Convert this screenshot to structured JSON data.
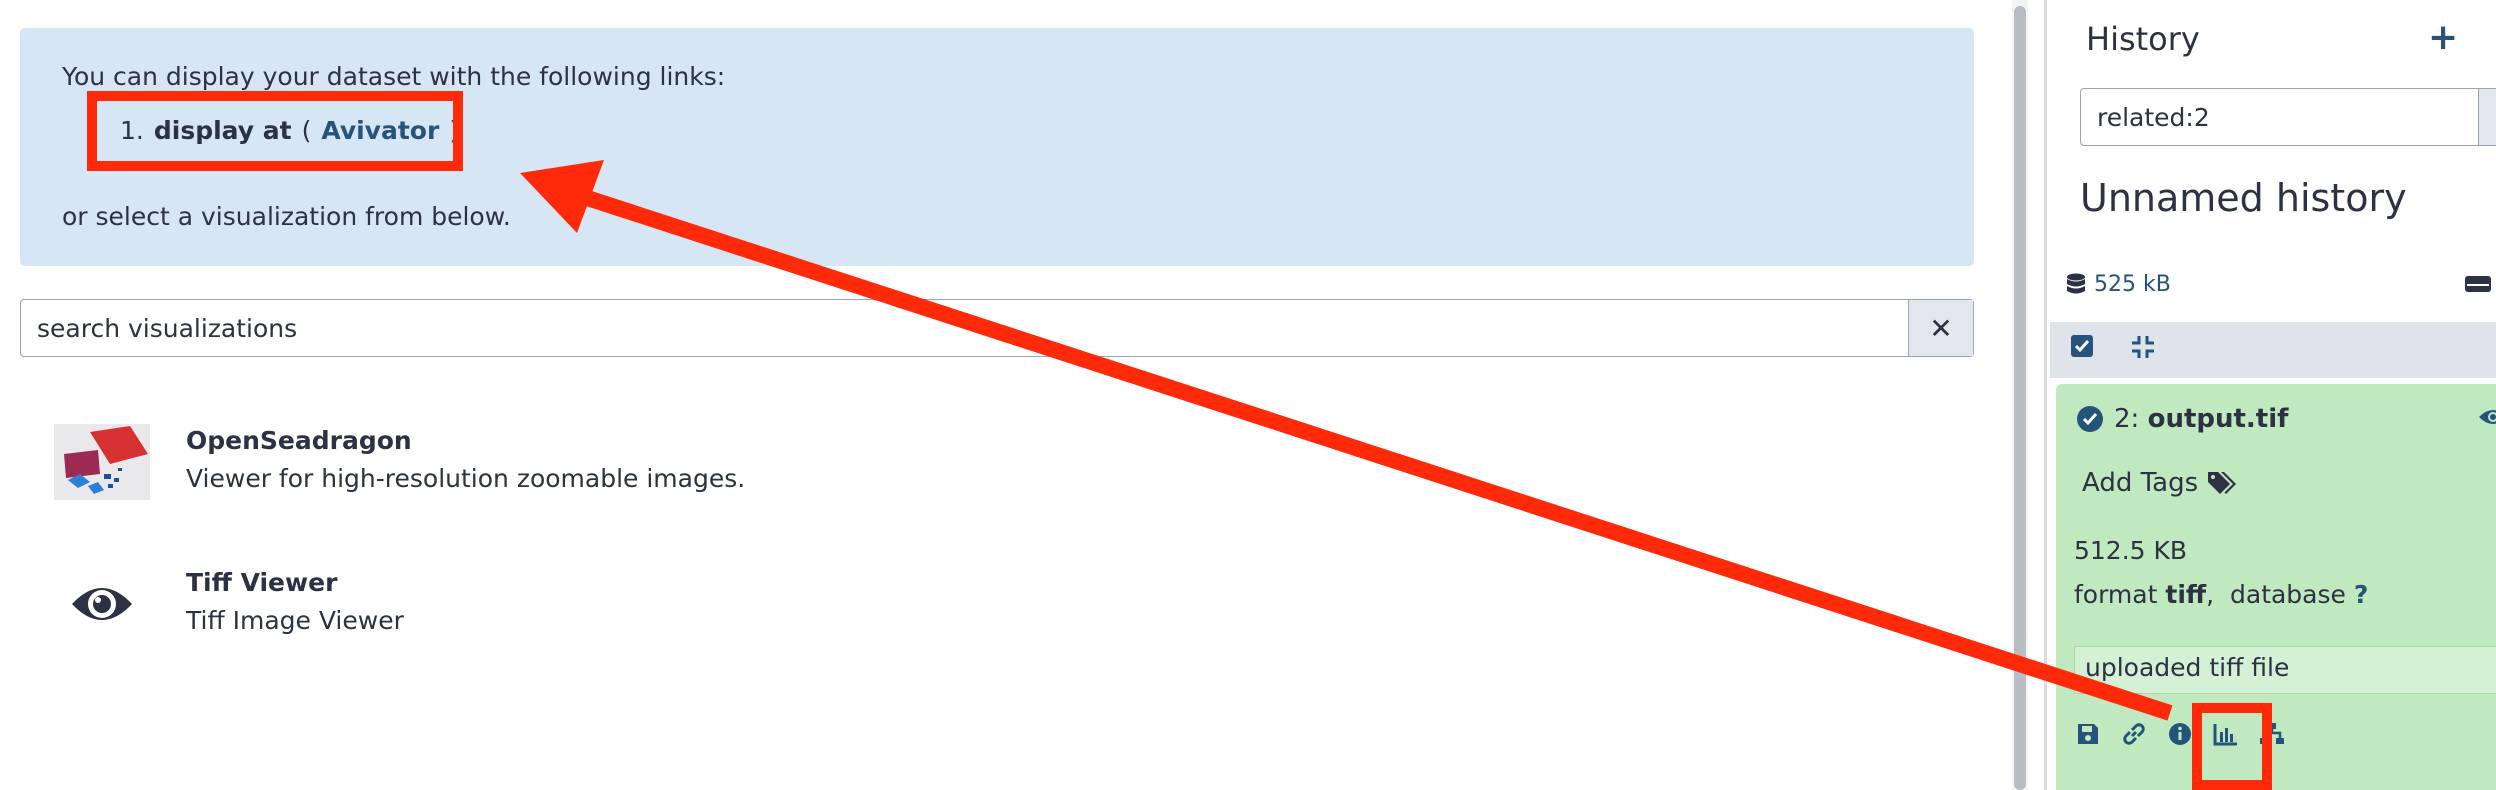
{
  "center": {
    "info": {
      "intro": "You can display your dataset with the following links:",
      "links": [
        {
          "num": "1.",
          "prefix": "display at",
          "open": "(",
          "link": "Avivator",
          "close": ")"
        }
      ],
      "outro": "or select a visualization from below."
    },
    "search": {
      "placeholder": "search visualizations",
      "clear": "✕"
    },
    "visualizations": [
      {
        "title": "OpenSeadragon",
        "description": "Viewer for high-resolution zoomable images."
      },
      {
        "title": "Tiff Viewer",
        "description": "Tiff Image Viewer"
      }
    ]
  },
  "history": {
    "title": "History",
    "new_button": "+",
    "filter_value": "related:2",
    "name": "Unnamed history",
    "size": "525 kB",
    "dataset": {
      "hid": "2:",
      "name": "output.tif",
      "add_tags": "Add Tags",
      "size": "512.5 KB",
      "format_label": "format",
      "format_value": "tiff",
      "database_label": "database",
      "database_value": "?",
      "peek": "uploaded tiff file"
    }
  },
  "colors": {
    "info_bg": "#d6e6f4",
    "link": "#25537b",
    "dataset_ok": "#c0e9c0",
    "annotation": "#ff2a0a"
  },
  "icons": [
    "close-icon",
    "openseadragon-thumbnail",
    "eye-icon",
    "plus-icon",
    "database-icon",
    "drive-icon",
    "check-square-icon",
    "collapse-icon",
    "check-circle-icon",
    "tags-icon",
    "save-icon",
    "link-icon",
    "info-icon",
    "chart-icon",
    "sitemap-icon"
  ]
}
